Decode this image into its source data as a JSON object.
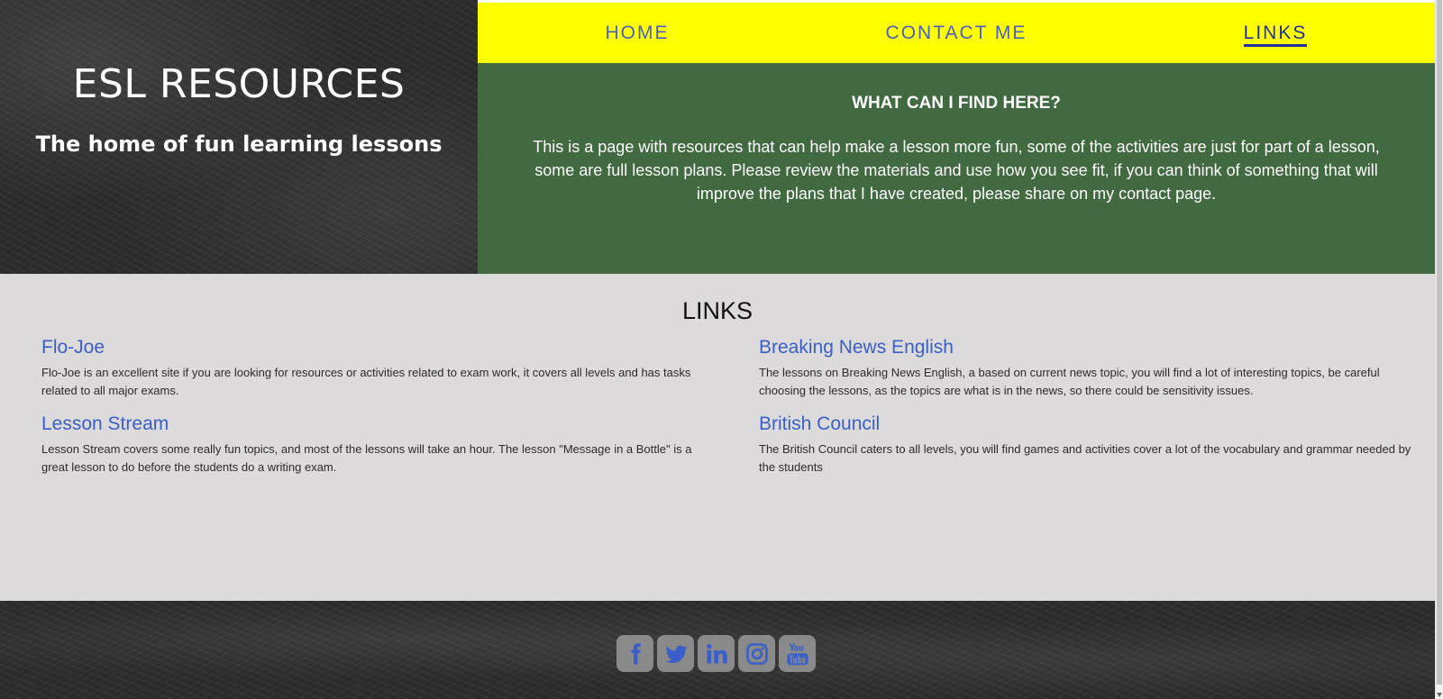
{
  "hero": {
    "title": "ESL RESOURCES",
    "tagline": "The home of fun learning lessons"
  },
  "nav": {
    "items": [
      {
        "label": "HOME"
      },
      {
        "label": "CONTACT ME"
      },
      {
        "label": "LINKS"
      }
    ],
    "active": "LINKS"
  },
  "intro": {
    "heading": "WHAT CAN I FIND HERE?",
    "text": "This is a page with resources that can help make a lesson more fun, some of the activities are just for part of a lesson, some are full lesson plans. Please review the materials and use how you see fit, if you can think of something that will improve the plans that I have created, please share on my contact page."
  },
  "links": {
    "title": "LINKS",
    "items": [
      {
        "name": "Flo-Joe",
        "description": "Flo-Joe is an excellent site if you are looking for resources or activities related to exam work, it covers all levels and has tasks related to all major exams."
      },
      {
        "name": "Breaking News English",
        "description": "The lessons on Breaking News English, a based on current news topic, you will find a lot of interesting topics, be careful choosing the lessons, as the topics are what is in the news, so there could be sensitivity issues."
      },
      {
        "name": "Lesson Stream",
        "description": "Lesson Stream covers some really fun topics, and most of the lessons will take an hour. The lesson \"Message in a Bottle\" is a great lesson to do before the students do a writing exam."
      },
      {
        "name": "British Council",
        "description": "The British Council caters to all levels, you will find games and activities cover a lot of the vocabulary and grammar needed by the students"
      }
    ]
  },
  "footer": {
    "social_icons": [
      "facebook-icon",
      "twitter-icon",
      "linkedin-icon",
      "instagram-icon",
      "youtube-icon"
    ]
  },
  "colors": {
    "nav_bg": "#ffff00",
    "nav_link": "#4a5fbf",
    "nav_active": "#1f2fa0",
    "intro_bg": "#416a41",
    "links_bg": "#dcdada",
    "link_title": "#3b5fc8",
    "social_btn": "#8a8a8a",
    "social_icon": "#3b5fc8"
  }
}
